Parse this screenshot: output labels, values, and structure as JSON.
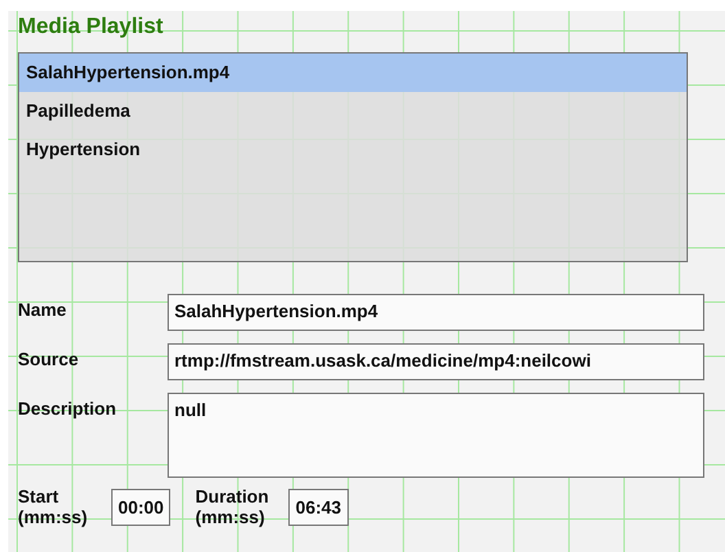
{
  "title": "Media Playlist",
  "playlist": {
    "items": [
      {
        "label": "SalahHypertension.mp4",
        "selected": true
      },
      {
        "label": "Papilledema",
        "selected": false
      },
      {
        "label": "Hypertension",
        "selected": false
      }
    ]
  },
  "fields": [
    {
      "label": "Name",
      "value": "SalahHypertension.mp4",
      "kind": "line"
    },
    {
      "label": "Source",
      "value": "rtmp://fmstream.usask.ca/medicine/mp4:neilcowi",
      "kind": "line"
    },
    {
      "label": "Description",
      "value": "null",
      "kind": "area"
    }
  ],
  "times": [
    {
      "label": "Start (mm:ss)",
      "value": "00:00"
    },
    {
      "label": "Duration (mm:ss)",
      "value": "06:43"
    }
  ]
}
